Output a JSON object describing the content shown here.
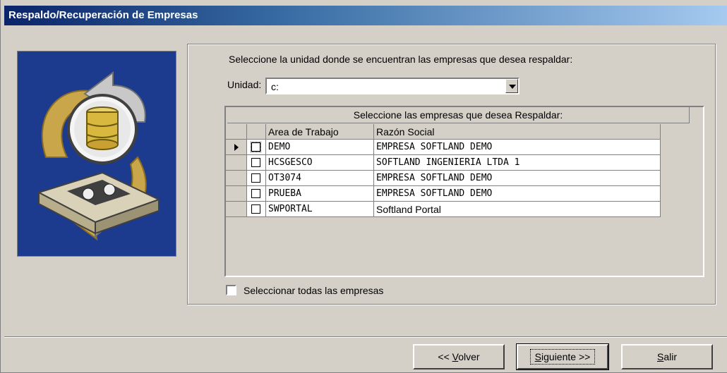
{
  "window": {
    "title": "Respaldo/Recuperación de Empresas"
  },
  "prompt": "Seleccione la unidad donde se encuentran las empresas que desea respaldar:",
  "unit": {
    "label": "Unidad:",
    "value": "c:"
  },
  "grid": {
    "caption": "Seleccione las empresas que desea Respaldar:",
    "columns": [
      "Area de Trabajo",
      "Razón Social"
    ],
    "rows": [
      {
        "area": "DEMO",
        "razon": "EMPRESA SOFTLAND DEMO",
        "current": true
      },
      {
        "area": "HCSGESCO",
        "razon": "SOFTLAND INGENIERIA LTDA 1",
        "current": false
      },
      {
        "area": "OT3074",
        "razon": "EMPRESA SOFTLAND DEMO",
        "current": false
      },
      {
        "area": "PRUEBA",
        "razon": "EMPRESA SOFTLAND DEMO",
        "current": false
      },
      {
        "area": "SWPORTAL",
        "razon": "Softland Portal",
        "current": false
      }
    ]
  },
  "select_all": {
    "label": "Seleccionar todas las empresas",
    "checked": false
  },
  "buttons": {
    "back": {
      "label": "<< Volver",
      "pre": "<< ",
      "accel": "V",
      "post": "olver"
    },
    "next": {
      "label": "Siguiente >>",
      "accel": "S",
      "post": "iguiente >>"
    },
    "exit": {
      "label": "Salir",
      "accel": "S",
      "post": "alir"
    }
  },
  "colors": {
    "titlebar_start": "#0a246a",
    "titlebar_end": "#a6caf0",
    "face": "#d4d0c8",
    "image_bg": "#1c3a8e"
  },
  "icons": {
    "wizard_image": "database-backup-illustration",
    "row_pointer": "row-pointer-icon",
    "dropdown": "chevron-down-icon"
  }
}
